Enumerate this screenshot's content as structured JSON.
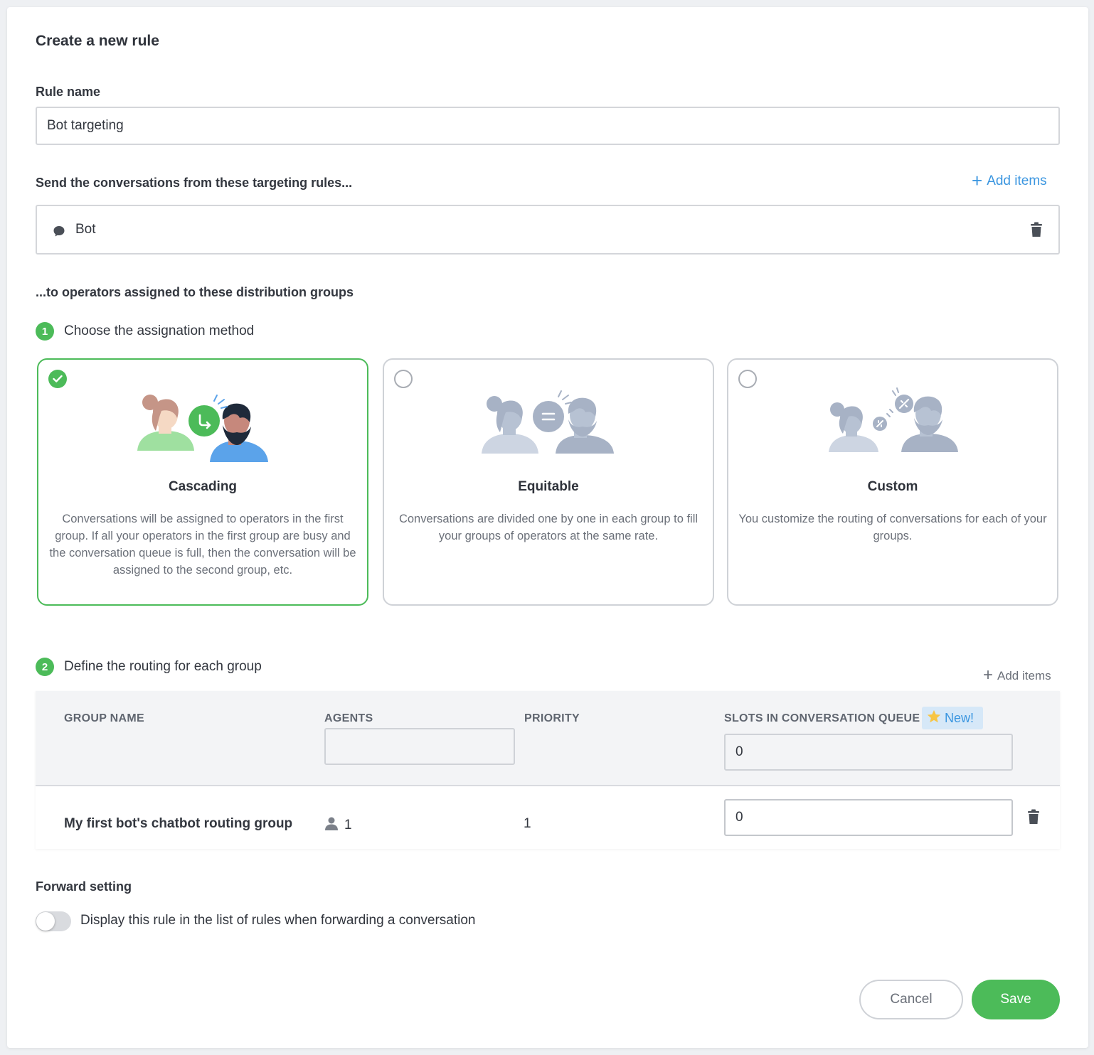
{
  "header": {
    "title": "Create a new rule"
  },
  "rule_name": {
    "label": "Rule name",
    "value": "Bot targeting"
  },
  "targeting": {
    "label": "Send the conversations from these targeting rules...",
    "add_items_label": "Add items",
    "items": [
      {
        "label": "Bot",
        "icon": "chat-bubble-icon"
      }
    ]
  },
  "distribution": {
    "label": "...to operators assigned to these distribution groups"
  },
  "step1": {
    "number": "1",
    "label": "Choose the assignation method"
  },
  "methods": [
    {
      "title": "Cascading",
      "description": "Conversations will be assigned to operators in the first group. If all your operators in the first group are busy and the conversation queue is full, then the conversation will be assigned to the second group, etc.",
      "selected": true
    },
    {
      "title": "Equitable",
      "description": "Conversations are divided one by one in each group to fill your groups of operators at the same rate.",
      "selected": false
    },
    {
      "title": "Custom",
      "description": "You customize the routing of conversations for each of your groups.",
      "selected": false
    }
  ],
  "step2": {
    "number": "2",
    "label": "Define the routing for each group",
    "add_items_label": "Add items"
  },
  "table": {
    "columns": [
      "GROUP NAME",
      "AGENTS",
      "PRIORITY",
      "SLOTS IN CONVERSATION QUEUE"
    ],
    "new_badge": "New!",
    "slots_default": "0",
    "rows": [
      {
        "group_name": "My first bot's chatbot routing group",
        "agents": "1",
        "priority": "1",
        "slots": "0"
      }
    ]
  },
  "forward": {
    "label": "Forward setting",
    "toggle_label": "Display this rule in the list of rules when forwarding a conversation",
    "enabled": false
  },
  "footer": {
    "cancel_label": "Cancel",
    "save_label": "Save"
  },
  "colors": {
    "accent_green": "#4cbb59",
    "link_blue": "#3b96e0",
    "text": "#33373f",
    "muted": "#6b7079"
  }
}
